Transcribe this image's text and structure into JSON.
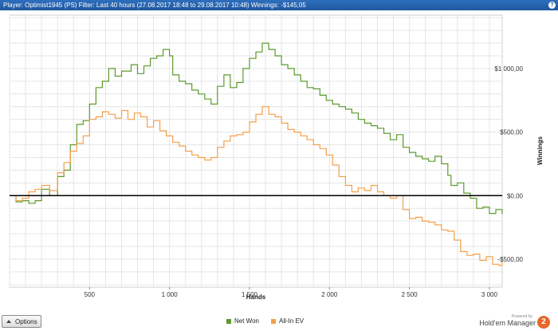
{
  "header": {
    "text": "Player: Optimist1945 (PS)  Filter: Last 40 hours (27.08.2017 18:48 to 29.08.2017 10:48)  Winnings: -$145,05",
    "help_glyph": "?"
  },
  "footer": {
    "options_label": "Options",
    "powered_by": "Powered by",
    "brand": "Hold'em Manager",
    "brand_badge": "2"
  },
  "colors": {
    "net_won": "#5c9a2c",
    "all_in_ev": "#f4a04a",
    "zero_line": "#000000",
    "grid": "#e6e6e6",
    "titlebar": "#1f579e",
    "badge": "#e8672a"
  },
  "chart_data": {
    "type": "line",
    "xlabel": "Hands",
    "ylabel": "Winnings",
    "xlim": [
      0,
      3080
    ],
    "ylim": [
      -720,
      1420
    ],
    "x_ticks": [
      {
        "value": 500,
        "label": "500"
      },
      {
        "value": 1000,
        "label": "1 000"
      },
      {
        "value": 1500,
        "label": "1 500"
      },
      {
        "value": 2000,
        "label": "2 000"
      },
      {
        "value": 2500,
        "label": "2 500"
      },
      {
        "value": 3000,
        "label": "3 000"
      }
    ],
    "y_ticks": [
      {
        "value": -500,
        "label": "-$500,00"
      },
      {
        "value": 0,
        "label": "$0,00"
      },
      {
        "value": 500,
        "label": "$500,00"
      },
      {
        "value": 1000,
        "label": "$1 000,00"
      }
    ],
    "grid": true,
    "legend": "bottom-center",
    "series": [
      {
        "name": "Net Won",
        "color": "#5c9a2c",
        "points": [
          [
            0,
            0
          ],
          [
            40,
            -50
          ],
          [
            80,
            -40
          ],
          [
            120,
            -60
          ],
          [
            160,
            -40
          ],
          [
            200,
            50
          ],
          [
            250,
            0
          ],
          [
            300,
            150
          ],
          [
            340,
            200
          ],
          [
            380,
            400
          ],
          [
            420,
            560
          ],
          [
            460,
            590
          ],
          [
            500,
            720
          ],
          [
            540,
            850
          ],
          [
            580,
            900
          ],
          [
            620,
            1000
          ],
          [
            660,
            940
          ],
          [
            700,
            980
          ],
          [
            760,
            1030
          ],
          [
            800,
            960
          ],
          [
            840,
            1020
          ],
          [
            880,
            1080
          ],
          [
            920,
            1100
          ],
          [
            960,
            1150
          ],
          [
            1000,
            1100
          ],
          [
            1020,
            950
          ],
          [
            1060,
            900
          ],
          [
            1100,
            880
          ],
          [
            1140,
            830
          ],
          [
            1180,
            800
          ],
          [
            1220,
            760
          ],
          [
            1260,
            720
          ],
          [
            1300,
            860
          ],
          [
            1340,
            950
          ],
          [
            1380,
            850
          ],
          [
            1420,
            890
          ],
          [
            1460,
            1000
          ],
          [
            1500,
            1080
          ],
          [
            1540,
            1130
          ],
          [
            1580,
            1200
          ],
          [
            1620,
            1150
          ],
          [
            1660,
            1100
          ],
          [
            1700,
            1030
          ],
          [
            1740,
            1000
          ],
          [
            1780,
            950
          ],
          [
            1820,
            900
          ],
          [
            1860,
            850
          ],
          [
            1900,
            840
          ],
          [
            1940,
            790
          ],
          [
            1980,
            750
          ],
          [
            2020,
            720
          ],
          [
            2060,
            700
          ],
          [
            2100,
            680
          ],
          [
            2140,
            650
          ],
          [
            2180,
            600
          ],
          [
            2220,
            570
          ],
          [
            2260,
            550
          ],
          [
            2300,
            530
          ],
          [
            2340,
            490
          ],
          [
            2380,
            440
          ],
          [
            2420,
            480
          ],
          [
            2460,
            380
          ],
          [
            2500,
            340
          ],
          [
            2540,
            310
          ],
          [
            2580,
            290
          ],
          [
            2620,
            270
          ],
          [
            2660,
            310
          ],
          [
            2700,
            250
          ],
          [
            2740,
            160
          ],
          [
            2760,
            80
          ],
          [
            2800,
            100
          ],
          [
            2840,
            20
          ],
          [
            2880,
            -20
          ],
          [
            2920,
            -100
          ],
          [
            2960,
            -90
          ],
          [
            3000,
            -140
          ],
          [
            3040,
            -110
          ],
          [
            3080,
            -145.05
          ]
        ]
      },
      {
        "name": "All-In EV",
        "color": "#f4a04a",
        "points": [
          [
            0,
            0
          ],
          [
            40,
            -40
          ],
          [
            80,
            -20
          ],
          [
            120,
            30
          ],
          [
            160,
            50
          ],
          [
            200,
            80
          ],
          [
            250,
            40
          ],
          [
            300,
            180
          ],
          [
            340,
            260
          ],
          [
            380,
            350
          ],
          [
            420,
            410
          ],
          [
            460,
            470
          ],
          [
            500,
            600
          ],
          [
            540,
            620
          ],
          [
            580,
            660
          ],
          [
            620,
            640
          ],
          [
            660,
            610
          ],
          [
            700,
            670
          ],
          [
            740,
            600
          ],
          [
            780,
            650
          ],
          [
            820,
            620
          ],
          [
            860,
            540
          ],
          [
            900,
            590
          ],
          [
            940,
            510
          ],
          [
            980,
            470
          ],
          [
            1020,
            420
          ],
          [
            1060,
            390
          ],
          [
            1100,
            350
          ],
          [
            1140,
            320
          ],
          [
            1180,
            300
          ],
          [
            1220,
            280
          ],
          [
            1260,
            300
          ],
          [
            1300,
            380
          ],
          [
            1340,
            430
          ],
          [
            1380,
            470
          ],
          [
            1420,
            480
          ],
          [
            1460,
            500
          ],
          [
            1500,
            580
          ],
          [
            1540,
            640
          ],
          [
            1580,
            700
          ],
          [
            1620,
            640
          ],
          [
            1660,
            620
          ],
          [
            1700,
            570
          ],
          [
            1740,
            520
          ],
          [
            1780,
            500
          ],
          [
            1820,
            470
          ],
          [
            1860,
            440
          ],
          [
            1900,
            400
          ],
          [
            1940,
            370
          ],
          [
            1980,
            320
          ],
          [
            2020,
            240
          ],
          [
            2060,
            150
          ],
          [
            2100,
            80
          ],
          [
            2140,
            30
          ],
          [
            2180,
            60
          ],
          [
            2220,
            40
          ],
          [
            2260,
            80
          ],
          [
            2300,
            30
          ],
          [
            2340,
            0
          ],
          [
            2380,
            -20
          ],
          [
            2420,
            0
          ],
          [
            2460,
            -110
          ],
          [
            2500,
            -180
          ],
          [
            2540,
            -170
          ],
          [
            2580,
            -200
          ],
          [
            2620,
            -210
          ],
          [
            2660,
            -230
          ],
          [
            2700,
            -270
          ],
          [
            2740,
            -280
          ],
          [
            2780,
            -350
          ],
          [
            2820,
            -440
          ],
          [
            2860,
            -470
          ],
          [
            2900,
            -460
          ],
          [
            2940,
            -510
          ],
          [
            2980,
            -480
          ],
          [
            3020,
            -540
          ],
          [
            3060,
            -550
          ],
          [
            3080,
            -520
          ]
        ]
      }
    ]
  }
}
